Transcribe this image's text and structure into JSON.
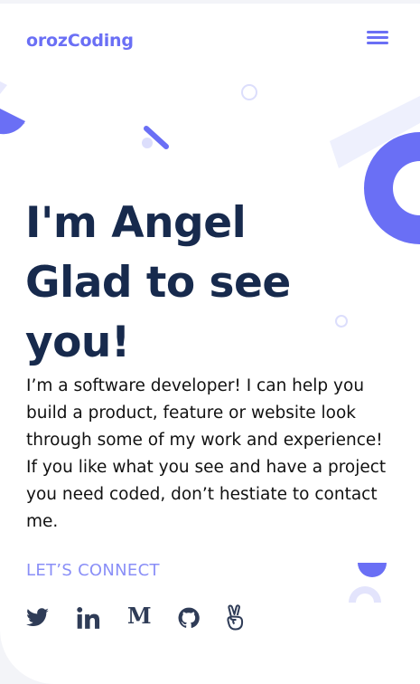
{
  "header": {
    "logo": "orozCoding",
    "menu_icon": "hamburger-menu-icon"
  },
  "hero": {
    "headline_lines": [
      "I'm Angel",
      "Glad to see",
      "you!"
    ],
    "intro": "I’m a software developer! I can help you build a product, feature or website look through some of my work and experience! If you like what you see and have a project you need coded, don’t hestiate to contact me.",
    "connect_label": "LET’S CONNECT"
  },
  "socials": [
    {
      "name": "twitter",
      "icon": "twitter-icon"
    },
    {
      "name": "linkedin",
      "icon": "linkedin-icon"
    },
    {
      "name": "medium",
      "icon": "medium-icon",
      "glyph": "M"
    },
    {
      "name": "github",
      "icon": "github-icon"
    },
    {
      "name": "angellist",
      "icon": "angellist-icon"
    }
  ],
  "colors": {
    "accent": "#6a6ff5",
    "accent_light": "#8a8ff7",
    "heading": "#172a4d",
    "text": "#111111",
    "icon": "#2f3c57",
    "deco_pale": "#e8e9fd"
  }
}
